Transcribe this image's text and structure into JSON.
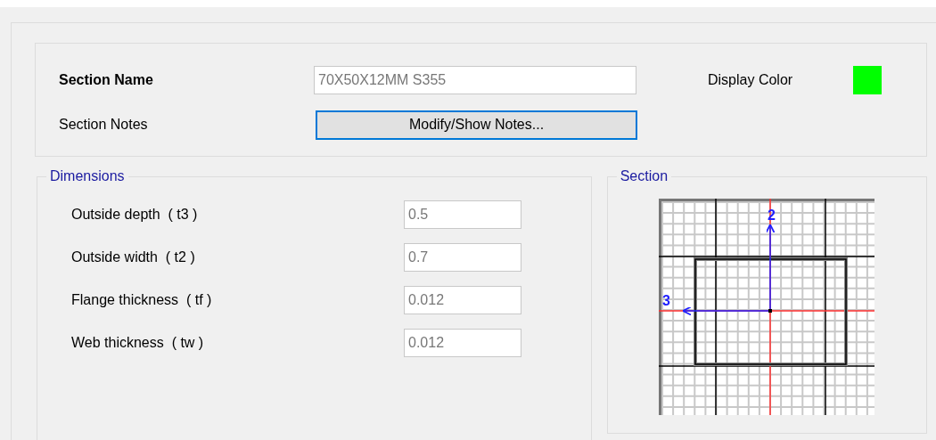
{
  "section_name": {
    "label": "Section Name",
    "value": "70X50X12MM S355"
  },
  "display_color": {
    "label": "Display Color",
    "color": "#00ff00"
  },
  "section_notes": {
    "label": "Section Notes",
    "button": "Modify/Show Notes..."
  },
  "dimensions": {
    "title": "Dimensions",
    "fields": [
      {
        "label": "Outside depth  ( t3 )",
        "value": "0.5"
      },
      {
        "label": "Outside width  ( t2 )",
        "value": "0.7"
      },
      {
        "label": "Flange thickness  ( tf )",
        "value": "0.012"
      },
      {
        "label": "Web thickness  ( tw )",
        "value": "0.012"
      }
    ]
  },
  "section": {
    "title": "Section",
    "axis_vertical": "2",
    "axis_horizontal": "3"
  }
}
